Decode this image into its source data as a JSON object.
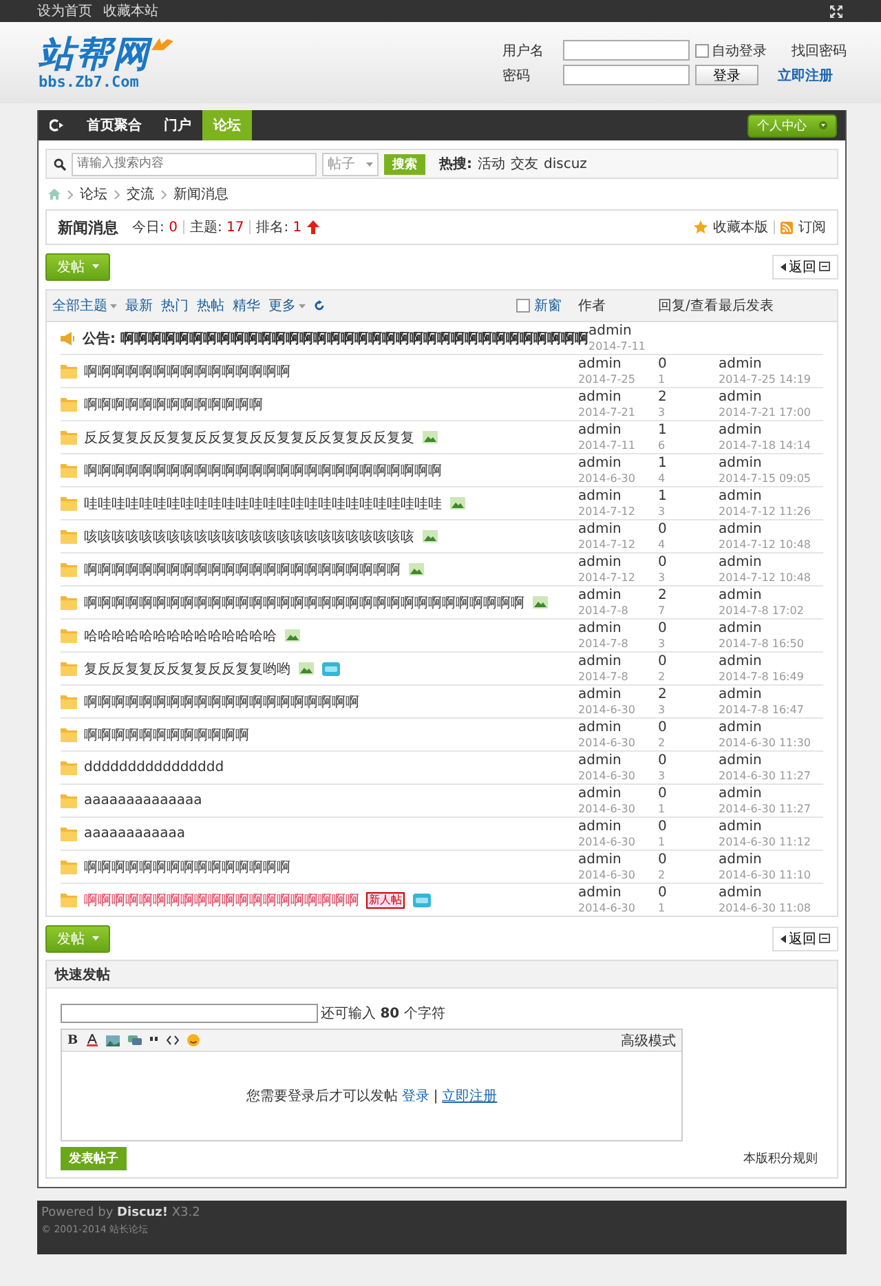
{
  "top_bar": {
    "links": [
      "设为首页",
      "收藏本站"
    ]
  },
  "logo": {
    "name": "站帮网",
    "domain": "bbs.Zb7.Com"
  },
  "login": {
    "username_label": "用户名",
    "password_label": "密码",
    "auto_login": {
      "label": "自动登录",
      "checked": false
    },
    "forgot": "找回密码",
    "login_button": "登录",
    "register": "立即注册"
  },
  "nav": {
    "items": [
      {
        "label": "首页聚合",
        "selected": false
      },
      {
        "label": "门户",
        "selected": false
      },
      {
        "label": "论坛",
        "selected": true
      }
    ],
    "user_center": "个人中心"
  },
  "search": {
    "placeholder": "请输入搜索内容",
    "scope": "帖子",
    "button": "搜索",
    "hot_label": "热搜:",
    "hot": [
      "活动",
      "交友",
      "discuz"
    ]
  },
  "breadcrumb": [
    "论坛",
    "交流",
    "新闻消息"
  ],
  "forum": {
    "name": "新闻消息",
    "stats": [
      {
        "label": "今日:",
        "value": "0"
      },
      {
        "label": "主题:",
        "value": "17"
      },
      {
        "label": "排名:",
        "value": "1"
      }
    ],
    "favorite": "收藏本版",
    "subscribe": "订阅"
  },
  "top_actions": {
    "post_button": "发帖",
    "back_button": "返回"
  },
  "filters": [
    {
      "label": "全部主题",
      "dropdown": true
    },
    {
      "label": "最新",
      "dropdown": false
    },
    {
      "label": "热门",
      "dropdown": false
    },
    {
      "label": "热帖",
      "dropdown": false
    },
    {
      "label": "精华",
      "dropdown": false
    },
    {
      "label": "更多",
      "dropdown": true
    }
  ],
  "new_window": {
    "label": "新窗",
    "checked": false
  },
  "columns": [
    "作者",
    "回复/查看",
    "最后发表"
  ],
  "announcement": {
    "label": "公告:",
    "title": "啊啊啊啊啊啊啊啊啊啊啊啊啊啊啊啊啊啊啊啊啊啊啊啊啊啊啊啊啊啊啊啊啊啊",
    "author": "admin",
    "date": "2014-7-11"
  },
  "threads": [
    {
      "title": "啊啊啊啊啊啊啊啊啊啊啊啊啊啊啊",
      "author": "admin",
      "date": "2014-7-25",
      "replies": "0",
      "views": "1",
      "last_author": "admin",
      "last_time": "2014-7-25 14:19",
      "attachment": false,
      "new": false,
      "highlight": false
    },
    {
      "title": "啊啊啊啊啊啊啊啊啊啊啊啊啊",
      "author": "admin",
      "date": "2014-7-21",
      "replies": "2",
      "views": "3",
      "last_author": "admin",
      "last_time": "2014-7-21 17:00",
      "attachment": false,
      "new": false,
      "highlight": false
    },
    {
      "title": "反反复复反反复复反反复复反反复复反反复复反反复复",
      "author": "admin",
      "date": "2014-7-11",
      "replies": "1",
      "views": "6",
      "last_author": "admin",
      "last_time": "2014-7-18 14:14",
      "attachment": true,
      "new": false,
      "highlight": false
    },
    {
      "title": "啊啊啊啊啊啊啊啊啊啊啊啊啊啊啊啊啊啊啊啊啊啊啊啊啊啊",
      "author": "admin",
      "date": "2014-6-30",
      "replies": "1",
      "views": "4",
      "last_author": "admin",
      "last_time": "2014-7-15 09:05",
      "attachment": false,
      "new": false,
      "highlight": false
    },
    {
      "title": "哇哇哇哇哇哇哇哇哇哇哇哇哇哇哇哇哇哇哇哇哇哇哇哇哇哇",
      "author": "admin",
      "date": "2014-7-12",
      "replies": "1",
      "views": "3",
      "last_author": "admin",
      "last_time": "2014-7-12 11:26",
      "attachment": true,
      "new": false,
      "highlight": false
    },
    {
      "title": "咳咳咳咳咳咳咳咳咳咳咳咳咳咳咳咳咳咳咳咳咳咳咳咳",
      "author": "admin",
      "date": "2014-7-12",
      "replies": "0",
      "views": "4",
      "last_author": "admin",
      "last_time": "2014-7-12 10:48",
      "attachment": true,
      "new": false,
      "highlight": false
    },
    {
      "title": "啊啊啊啊啊啊啊啊啊啊啊啊啊啊啊啊啊啊啊啊啊啊啊",
      "author": "admin",
      "date": "2014-7-12",
      "replies": "0",
      "views": "3",
      "last_author": "admin",
      "last_time": "2014-7-12 10:48",
      "attachment": true,
      "new": false,
      "highlight": false
    },
    {
      "title": "啊啊啊啊啊啊啊啊啊啊啊啊啊啊啊啊啊啊啊啊啊啊啊啊啊啊啊啊啊啊啊啊",
      "author": "admin",
      "date": "2014-7-8",
      "replies": "2",
      "views": "7",
      "last_author": "admin",
      "last_time": "2014-7-8 17:02",
      "attachment": true,
      "new": false,
      "highlight": false
    },
    {
      "title": "哈哈哈哈哈哈哈哈哈哈哈哈哈哈",
      "author": "admin",
      "date": "2014-7-8",
      "replies": "0",
      "views": "3",
      "last_author": "admin",
      "last_time": "2014-7-8 16:50",
      "attachment": true,
      "new": false,
      "highlight": false
    },
    {
      "title": "复反反复复反反复复反反复复哟哟",
      "author": "admin",
      "date": "2014-7-8",
      "replies": "0",
      "views": "2",
      "last_author": "admin",
      "last_time": "2014-7-8 16:49",
      "attachment": true,
      "new": true,
      "highlight": false
    },
    {
      "title": "啊啊啊啊啊啊啊啊啊啊啊啊啊啊啊啊啊啊啊啊",
      "author": "admin",
      "date": "2014-6-30",
      "replies": "2",
      "views": "3",
      "last_author": "admin",
      "last_time": "2014-7-8 16:47",
      "attachment": false,
      "new": false,
      "highlight": false
    },
    {
      "title": "啊啊啊啊啊啊啊啊啊啊啊啊",
      "author": "admin",
      "date": "2014-6-30",
      "replies": "0",
      "views": "2",
      "last_author": "admin",
      "last_time": "2014-6-30 11:30",
      "attachment": false,
      "new": false,
      "highlight": false
    },
    {
      "title": "dddddddddddddddd",
      "author": "admin",
      "date": "2014-6-30",
      "replies": "0",
      "views": "3",
      "last_author": "admin",
      "last_time": "2014-6-30 11:27",
      "attachment": false,
      "new": false,
      "highlight": false
    },
    {
      "title": "aaaaaaaaaaaaaa",
      "author": "admin",
      "date": "2014-6-30",
      "replies": "0",
      "views": "1",
      "last_author": "admin",
      "last_time": "2014-6-30 11:27",
      "attachment": false,
      "new": false,
      "highlight": false
    },
    {
      "title": "aaaaaaaaaaaa",
      "author": "admin",
      "date": "2014-6-30",
      "replies": "0",
      "views": "1",
      "last_author": "admin",
      "last_time": "2014-6-30 11:12",
      "attachment": false,
      "new": false,
      "highlight": false
    },
    {
      "title": "啊啊啊啊啊啊啊啊啊啊啊啊啊啊啊",
      "author": "admin",
      "date": "2014-6-30",
      "replies": "0",
      "views": "2",
      "last_author": "admin",
      "last_time": "2014-6-30 11:10",
      "attachment": false,
      "new": false,
      "highlight": false
    },
    {
      "title": "啊啊啊啊啊啊啊啊啊啊啊啊啊啊啊啊啊啊啊啊",
      "author": "admin",
      "date": "2014-6-30",
      "replies": "0",
      "views": "1",
      "last_author": "admin",
      "last_time": "2014-6-30 11:08",
      "attachment": false,
      "new": true,
      "highlight": true,
      "badge": "新人帖"
    }
  ],
  "bottom_actions": {
    "post_button": "发帖",
    "back_button": "返回"
  },
  "quick_post": {
    "title": "快速发帖",
    "remaining": "还可输入 **80** 个字符",
    "bold_tool": "B",
    "advanced": "高级模式",
    "notice": "您需要登录后才可以发帖",
    "login_link": "登录",
    "separator": "|",
    "register_link": "立即注册",
    "submit": "发表帖子",
    "rules": "本版积分规则"
  },
  "footer": {
    "powered": "Powered by **Discuz!** X3.2",
    "copyright": "© 2001-2014 站长论坛"
  }
}
